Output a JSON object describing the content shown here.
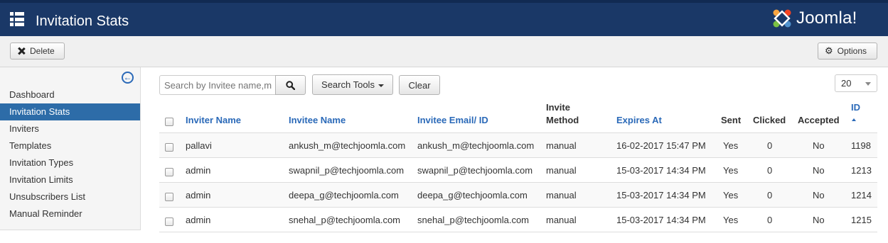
{
  "header": {
    "title": "Invitation Stats",
    "brand": "Joomla!"
  },
  "toolbar": {
    "delete_label": "Delete",
    "options_label": "Options"
  },
  "sidebar": {
    "items": [
      {
        "label": "Dashboard",
        "active": false
      },
      {
        "label": "Invitation Stats",
        "active": true
      },
      {
        "label": "Inviters",
        "active": false
      },
      {
        "label": "Templates",
        "active": false
      },
      {
        "label": "Invitation Types",
        "active": false
      },
      {
        "label": "Invitation Limits",
        "active": false
      },
      {
        "label": "Unsubscribers List",
        "active": false
      },
      {
        "label": "Manual Reminder",
        "active": false
      }
    ]
  },
  "filters": {
    "search_placeholder": "Search by Invitee name,m",
    "search_tools_label": "Search Tools",
    "clear_label": "Clear",
    "limit_value": "20"
  },
  "table": {
    "headers": {
      "inviter": "Inviter Name",
      "invitee": "Invitee Name",
      "email": "Invitee Email/ ID",
      "method_line1": "Invite",
      "method_line2": "Method",
      "expires": "Expires At",
      "sent": "Sent",
      "clicked": "Clicked",
      "accepted": "Accepted",
      "id": "ID"
    },
    "rows": [
      {
        "inviter": "pallavi",
        "invitee": "ankush_m@techjoomla.com",
        "email": "ankush_m@techjoomla.com",
        "method": "manual",
        "expires": "16-02-2017 15:47 PM",
        "sent": "Yes",
        "clicked": "0",
        "accepted": "No",
        "id": "1198"
      },
      {
        "inviter": "admin",
        "invitee": "swapnil_p@techjoomla.com",
        "email": "swapnil_p@techjoomla.com",
        "method": "manual",
        "expires": "15-03-2017 14:34 PM",
        "sent": "Yes",
        "clicked": "0",
        "accepted": "No",
        "id": "1213"
      },
      {
        "inviter": "admin",
        "invitee": "deepa_g@techjoomla.com",
        "email": "deepa_g@techjoomla.com",
        "method": "manual",
        "expires": "15-03-2017 14:34 PM",
        "sent": "Yes",
        "clicked": "0",
        "accepted": "No",
        "id": "1214"
      },
      {
        "inviter": "admin",
        "invitee": "snehal_p@techjoomla.com",
        "email": "snehal_p@techjoomla.com",
        "method": "manual",
        "expires": "15-03-2017 14:34 PM",
        "sent": "Yes",
        "clicked": "0",
        "accepted": "No",
        "id": "1215"
      }
    ]
  },
  "colors": {
    "header_bg": "#1a3867",
    "active_nav": "#2d6ca8",
    "link": "#2a69b8"
  },
  "icons": [
    "menu-icon",
    "joomla-logo-icon",
    "close-icon",
    "gear-icon",
    "collapse-arrow-icon",
    "search-icon",
    "caret-down-icon",
    "sort-asc-icon"
  ]
}
